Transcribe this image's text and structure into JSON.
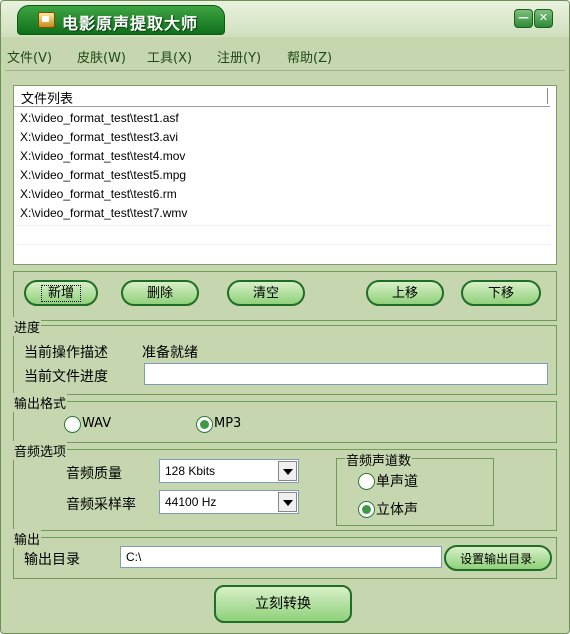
{
  "window": {
    "title": "电影原声提取大师",
    "minimize": "—",
    "close": "✕"
  },
  "menu": [
    "文件(V)",
    "皮肤(W)",
    "工具(X)",
    "注册(Y)",
    "帮助(Z)"
  ],
  "file_list": {
    "header": "文件列表",
    "files": [
      "X:\\video_format_test\\test1.asf",
      "X:\\video_format_test\\test3.avi",
      "X:\\video_format_test\\test4.mov",
      "X:\\video_format_test\\test5.mpg",
      "X:\\video_format_test\\test6.rm",
      "X:\\video_format_test\\test7.wmv"
    ]
  },
  "actions": {
    "add": "新增",
    "delete": "删除",
    "clear": "清空",
    "move_up": "上移",
    "move_down": "下移"
  },
  "progress": {
    "legend": "进度",
    "op_label": "当前操作描述",
    "op_value": "准备就绪",
    "file_progress_label": "当前文件进度",
    "file_progress_fraction": 0
  },
  "output_format": {
    "legend": "输出格式",
    "options": [
      "WAV",
      "MP3"
    ],
    "selected": "MP3"
  },
  "audio_options": {
    "legend": "音频选项",
    "quality_label": "音频质量",
    "quality_value": "128 Kbits",
    "sample_rate_label": "音频采样率",
    "sample_rate_value": "44100 Hz"
  },
  "channels": {
    "legend": "音频声道数",
    "options": [
      "单声道",
      "立体声"
    ],
    "selected": "立体声"
  },
  "output": {
    "legend": "输出",
    "dir_label": "输出目录",
    "dir_value": "C:\\",
    "set_dir_button": "设置输出目录."
  },
  "convert_button": "立刻转换",
  "colors": {
    "window_bg": "#c6d7b0",
    "title_green": "#1f8a2a",
    "button_green": "#8fd07a"
  }
}
